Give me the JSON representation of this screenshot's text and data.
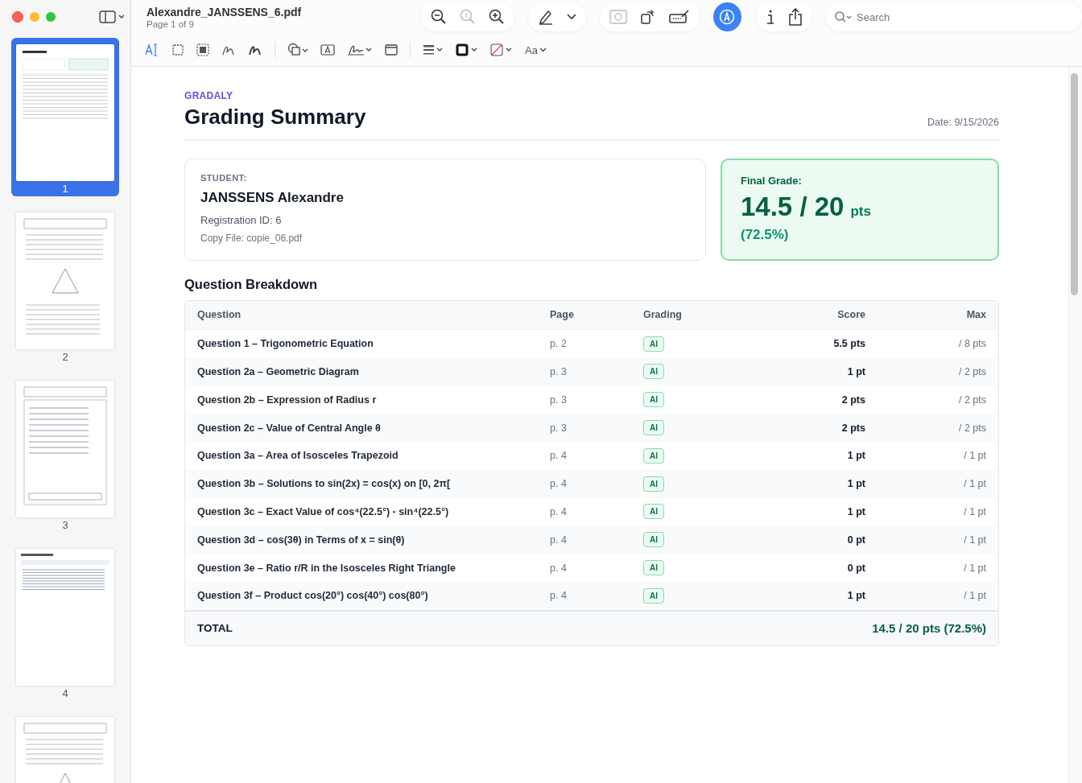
{
  "window": {
    "title": "Alexandre_JANSSENS_6.pdf",
    "subtitle": "Page 1 of 9"
  },
  "markup_toolbar": {
    "selected": true
  },
  "format_toolbar": {
    "font_label": "Aa"
  },
  "search": {
    "placeholder": "Search"
  },
  "thumbnails": [
    {
      "label": "1",
      "selected": true,
      "kind": "summary"
    },
    {
      "label": "2",
      "selected": false,
      "kind": "diagram"
    },
    {
      "label": "3",
      "selected": false,
      "kind": "equations"
    },
    {
      "label": "4",
      "selected": false,
      "kind": "notes"
    },
    {
      "selected": false,
      "kind": "diagram"
    }
  ],
  "document": {
    "brand": "GRADALY",
    "title": "Grading Summary",
    "date": "Date: 9/15/2026",
    "student": {
      "label": "STUDENT:",
      "name": "JANSSENS Alexandre",
      "registration": "Registration ID: 6",
      "file": "Copy File: copie_06.pdf"
    },
    "final_grade": {
      "label": "Final Grade:",
      "score": "14.5 / 20",
      "unit": "pts",
      "percent": "(72.5%)"
    },
    "section_title": "Question Breakdown",
    "table": {
      "columns": [
        "Question",
        "Page",
        "Grading",
        "Score",
        "Max"
      ],
      "rows": [
        {
          "question": "Question 1 – Trigonometric Equation",
          "page": "p. 2",
          "grading": "AI",
          "score": "5.5 pts",
          "max": "/ 8 pts"
        },
        {
          "question": "Question 2a – Geometric Diagram",
          "page": "p. 3",
          "grading": "AI",
          "score": "1 pt",
          "max": "/ 2 pts"
        },
        {
          "question": "Question 2b – Expression of Radius r",
          "page": "p. 3",
          "grading": "AI",
          "score": "2 pts",
          "max": "/ 2 pts"
        },
        {
          "question": "Question 2c – Value of Central Angle θ",
          "page": "p. 3",
          "grading": "AI",
          "score": "2 pts",
          "max": "/ 2 pts"
        },
        {
          "question": "Question 3a – Area of Isosceles Trapezoid",
          "page": "p. 4",
          "grading": "AI",
          "score": "1 pt",
          "max": "/ 1 pt"
        },
        {
          "question": "Question 3b – Solutions to sin(2x) = cos(x) on [0, 2π[",
          "page": "p. 4",
          "grading": "AI",
          "score": "1 pt",
          "max": "/ 1 pt"
        },
        {
          "question": "Question 3c – Exact Value of cos⁴(22.5°) - sin⁴(22.5°)",
          "page": "p. 4",
          "grading": "AI",
          "score": "1 pt",
          "max": "/ 1 pt"
        },
        {
          "question": "Question 3d – cos(3θ) in Terms of x = sin(θ)",
          "page": "p. 4",
          "grading": "AI",
          "score": "0 pt",
          "max": "/ 1 pt"
        },
        {
          "question": "Question 3e – Ratio r/R in the Isosceles Right Triangle",
          "page": "p. 4",
          "grading": "AI",
          "score": "0 pt",
          "max": "/ 1 pt"
        },
        {
          "question": "Question 3f – Product cos(20°) cos(40°) cos(80°)",
          "page": "p. 4",
          "grading": "AI",
          "score": "1 pt",
          "max": "/ 1 pt"
        }
      ],
      "total": {
        "label": "TOTAL",
        "value": "14.5 / 20 pts (72.5%)"
      }
    }
  }
}
